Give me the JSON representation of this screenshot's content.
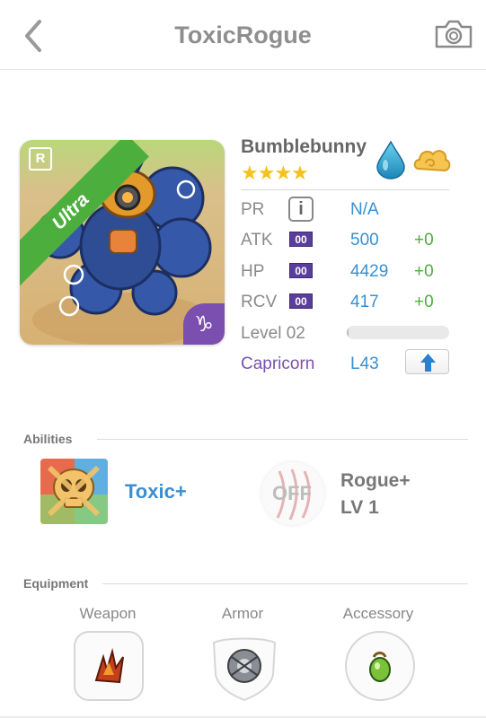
{
  "header": {
    "title": "ToxicRogue",
    "back_icon": "chevron-left-icon",
    "camera_icon": "camera-icon"
  },
  "monster": {
    "name": "Bumblebunny",
    "stars": "★★★★",
    "star_count": 4,
    "rarity_ribbon": "Ultra",
    "rarity_badge": "R",
    "zodiac_symbol": "♑",
    "element_icon": "water-drop-icon",
    "secondary_icon": "cloud-icon"
  },
  "stats": [
    {
      "label": "PR",
      "value": "N/A",
      "bonus": "",
      "badge": ""
    },
    {
      "label": "ATK",
      "value": "500",
      "bonus": "+0",
      "badge": "00"
    },
    {
      "label": "HP",
      "value": "4429",
      "bonus": "+0",
      "badge": "00"
    },
    {
      "label": "RCV",
      "value": "417",
      "bonus": "+0",
      "badge": "00"
    }
  ],
  "level": {
    "label": "Level 02",
    "progress": 0.02
  },
  "sign": {
    "name": "Capricorn",
    "level": "L43"
  },
  "abilities": {
    "section_label": "Abilities",
    "primary": {
      "name": "Toxic+",
      "icon": "toxic-skull-icon"
    },
    "secondary": {
      "status": "OFF",
      "name": "Rogue+",
      "level": "LV 1",
      "icon": "claw-marks-icon"
    }
  },
  "equipment": {
    "section_label": "Equipment",
    "slots": [
      {
        "label": "Weapon",
        "icon": "fire-claw-icon"
      },
      {
        "label": "Armor",
        "icon": "steel-shield-icon"
      },
      {
        "label": "Accessory",
        "icon": "green-gem-icon"
      }
    ]
  },
  "colors": {
    "accent_blue": "#3a8fd0",
    "bonus_green": "#4cae3d",
    "zodiac_purple": "#7b4fb0",
    "star_gold": "#f3c21b",
    "ribbon_green": "#4caf3d"
  }
}
